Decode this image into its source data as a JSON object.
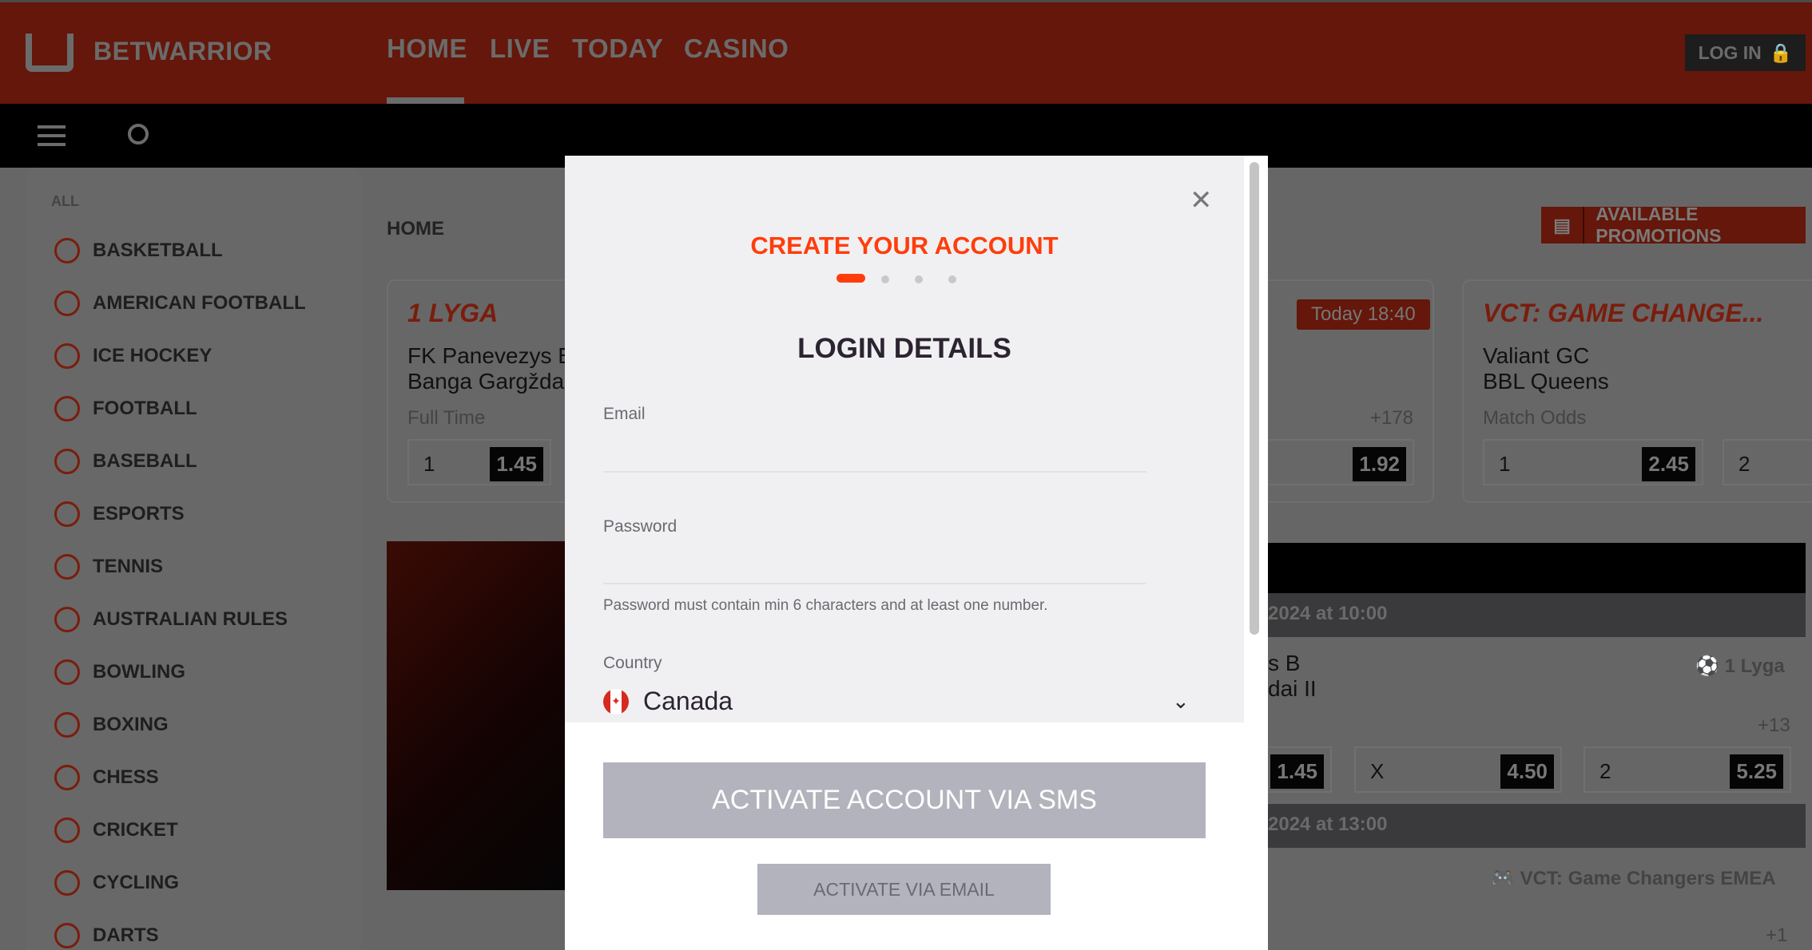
{
  "brand": {
    "name": "BETWARRIOR",
    "accent": "#ff3d0b",
    "header_color": "#64170a"
  },
  "nav": [
    "HOME",
    "LIVE",
    "TODAY",
    "CASINO"
  ],
  "login_label": "LOG IN",
  "sidebar": {
    "all": "ALL",
    "items": [
      "BASKETBALL",
      "AMERICAN FOOTBALL",
      "ICE HOCKEY",
      "FOOTBALL",
      "BASEBALL",
      "ESPORTS",
      "TENNIS",
      "AUSTRALIAN RULES",
      "BOWLING",
      "BOXING",
      "CHESS",
      "CRICKET",
      "CYCLING",
      "DARTS"
    ]
  },
  "breadcrumb": "HOME",
  "promotions": "AVAILABLE PROMOTIONS",
  "cards": [
    {
      "league": "1 LYGA",
      "team1": "FK Panevezys B",
      "team2": "Banga Gargždai II",
      "market": "Full Time",
      "odds": [
        {
          "label": "1",
          "value": "1.45"
        }
      ]
    },
    {
      "badge": "Today 18:40",
      "more": "+178",
      "odds": [
        {
          "value": "1.92"
        }
      ]
    },
    {
      "league": "VCT: GAME CHANGE...",
      "team1": "Valiant GC",
      "team2": "BBL Queens",
      "market": "Match Odds",
      "odds": [
        {
          "label": "1",
          "value": "2.45"
        },
        {
          "label": "2"
        }
      ]
    }
  ],
  "events": [
    {
      "date": "2024 at 10:00",
      "team1": "s B",
      "team2": "dai II",
      "league": "1 Lyga",
      "more": "+13",
      "odds": [
        {
          "value": "1.45"
        },
        {
          "label": "X",
          "value": "4.50"
        },
        {
          "label": "2",
          "value": "5.25"
        }
      ]
    },
    {
      "date": "2024 at 13:00",
      "league": "VCT: Game Changers EMEA",
      "more": "+1"
    }
  ],
  "modal": {
    "title": "CREATE YOUR ACCOUNT",
    "step": 1,
    "steps": 4,
    "section": "LOGIN DETAILS",
    "email_label": "Email",
    "email_value": "",
    "password_label": "Password",
    "password_value": "",
    "password_hint": "Password must contain min 6 characters and at least one number.",
    "country_label": "Country",
    "country_value": "Canada",
    "sms_button": "ACTIVATE ACCOUNT VIA SMS",
    "email_button": "ACTIVATE VIA EMAIL"
  }
}
